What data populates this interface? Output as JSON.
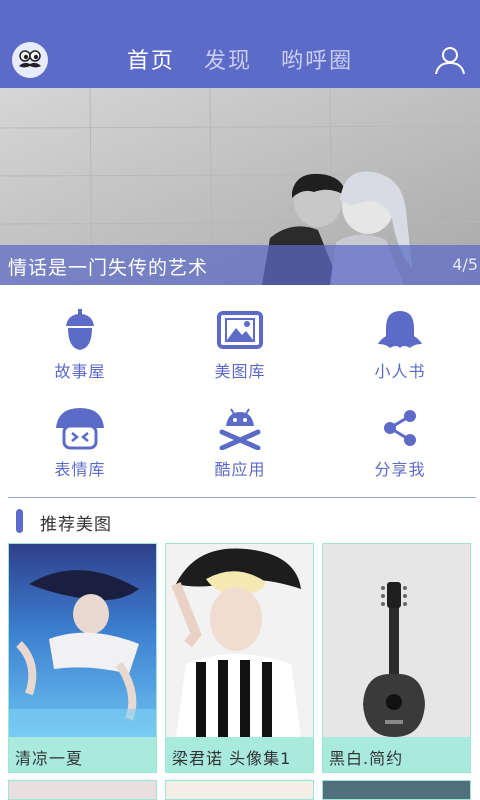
{
  "header": {
    "tabs": [
      {
        "label": "首页",
        "active": true
      },
      {
        "label": "发现",
        "active": false
      },
      {
        "label": "哟呼圈",
        "active": false
      }
    ]
  },
  "banner": {
    "title": "情话是一门失传的艺术",
    "page": "4/5"
  },
  "categories": [
    {
      "label": "故事屋",
      "icon": "acorn-icon"
    },
    {
      "label": "美图库",
      "icon": "picture-frame-icon"
    },
    {
      "label": "小人书",
      "icon": "ghost-icon"
    },
    {
      "label": "表情库",
      "icon": "mushroom-face-icon"
    },
    {
      "label": "酷应用",
      "icon": "android-crossbones-icon"
    },
    {
      "label": "分享我",
      "icon": "share-icon"
    }
  ],
  "section": {
    "title": "推荐美图"
  },
  "cards": [
    {
      "caption": "清凉一夏"
    },
    {
      "caption": "梁君诺 头像集1"
    },
    {
      "caption": "黑白.简约"
    }
  ],
  "colors": {
    "primary": "#5c6bc8",
    "card_caption_bg": "#a8eadb"
  }
}
